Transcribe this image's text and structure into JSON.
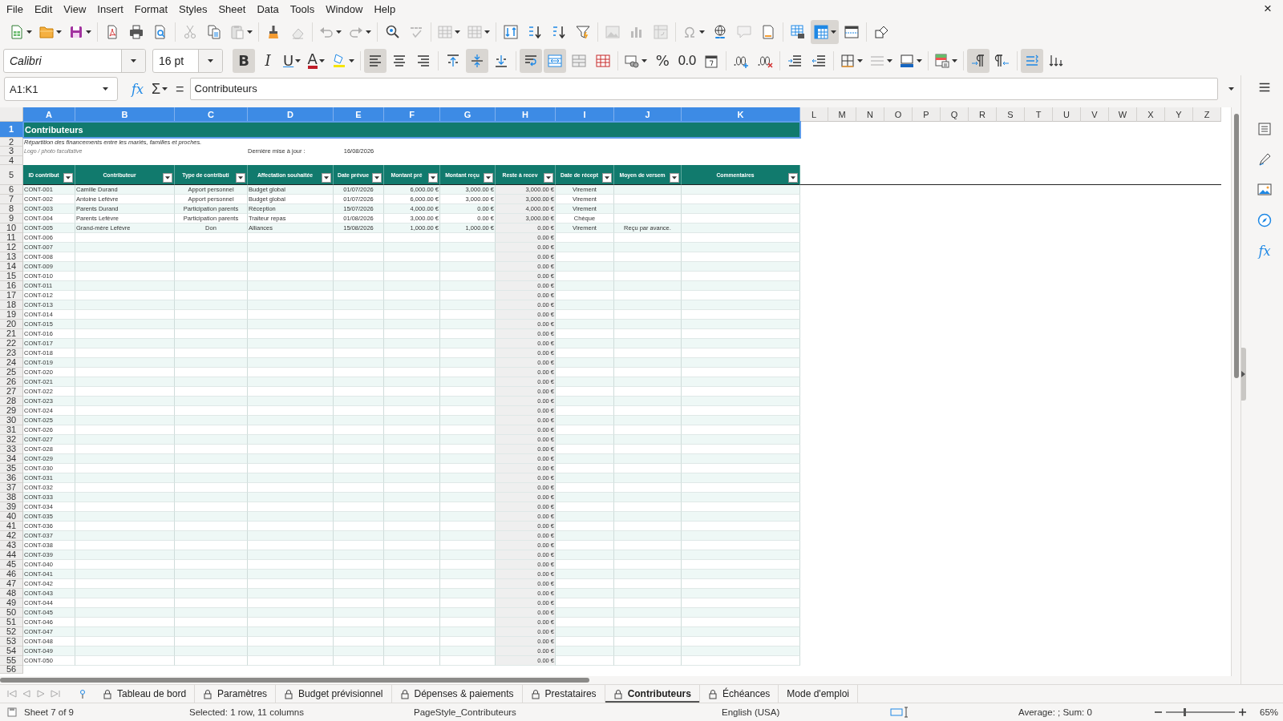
{
  "menu": [
    "File",
    "Edit",
    "View",
    "Insert",
    "Format",
    "Styles",
    "Sheet",
    "Data",
    "Tools",
    "Window",
    "Help"
  ],
  "close": "×",
  "toolbars": [
    {
      "groups": [
        [
          {
            "kind": "new",
            "dropdown": true,
            "active": false,
            "disabled": false
          },
          {
            "kind": "open",
            "dropdown": true,
            "active": false,
            "disabled": false
          },
          {
            "kind": "save",
            "dropdown": true,
            "active": false,
            "disabled": false
          }
        ],
        [
          {
            "kind": "export_pdf",
            "dropdown": false,
            "active": false,
            "disabled": false
          },
          {
            "kind": "print",
            "dropdown": false,
            "active": false,
            "disabled": false
          },
          {
            "kind": "print_preview",
            "dropdown": false,
            "active": false,
            "disabled": false
          }
        ],
        [
          {
            "kind": "cut",
            "dropdown": false,
            "active": false,
            "disabled": true
          },
          {
            "kind": "copy",
            "dropdown": false,
            "active": false,
            "disabled": false
          },
          {
            "kind": "paste",
            "dropdown": true,
            "active": false,
            "disabled": true
          }
        ],
        [
          {
            "kind": "clone_format",
            "dropdown": false,
            "active": false,
            "disabled": false
          },
          {
            "kind": "clear_format",
            "dropdown": false,
            "active": false,
            "disabled": true
          }
        ],
        [
          {
            "kind": "undo",
            "dropdown": true,
            "active": false,
            "disabled": true
          },
          {
            "kind": "redo",
            "dropdown": true,
            "active": false,
            "disabled": true
          }
        ],
        [
          {
            "kind": "find_replace",
            "dropdown": false,
            "active": false,
            "disabled": false
          },
          {
            "kind": "spelling",
            "dropdown": false,
            "active": false,
            "disabled": true
          }
        ],
        [
          {
            "kind": "rows",
            "dropdown": true,
            "active": false,
            "disabled": true
          },
          {
            "kind": "columns",
            "dropdown": true,
            "active": false,
            "disabled": true
          }
        ],
        [
          {
            "kind": "sort",
            "dropdown": false,
            "active": false,
            "disabled": false
          },
          {
            "kind": "sort_asc",
            "dropdown": false,
            "active": false,
            "disabled": false
          },
          {
            "kind": "sort_desc",
            "dropdown": false,
            "active": false,
            "disabled": false
          },
          {
            "kind": "autofilter",
            "dropdown": false,
            "active": false,
            "disabled": false
          }
        ],
        [
          {
            "kind": "image",
            "dropdown": false,
            "active": false,
            "disabled": true
          },
          {
            "kind": "chart",
            "dropdown": false,
            "active": false,
            "disabled": true
          },
          {
            "kind": "pivot",
            "dropdown": false,
            "active": false,
            "disabled": true
          }
        ],
        [
          {
            "kind": "special_char",
            "dropdown": true,
            "active": false,
            "disabled": true
          },
          {
            "kind": "hyperlink",
            "dropdown": false,
            "active": false,
            "disabled": false
          },
          {
            "kind": "comment",
            "dropdown": false,
            "active": false,
            "disabled": true
          },
          {
            "kind": "header_footer",
            "dropdown": false,
            "active": false,
            "disabled": false
          }
        ],
        [
          {
            "kind": "print_area",
            "dropdown": false,
            "active": false,
            "disabled": false
          },
          {
            "kind": "freeze",
            "dropdown": true,
            "active": true,
            "disabled": false
          },
          {
            "kind": "split_window",
            "dropdown": false,
            "active": false,
            "disabled": false
          }
        ],
        [
          {
            "kind": "shapes",
            "dropdown": false,
            "active": false,
            "disabled": false
          }
        ]
      ]
    },
    {
      "font_name": "Calibri",
      "font_size": "16 pt",
      "groups": [
        [
          {
            "kind": "bold",
            "glyph": "B",
            "dropdown": false,
            "active": true,
            "disabled": false
          },
          {
            "kind": "italic",
            "glyph": "I",
            "dropdown": false,
            "active": false,
            "disabled": false
          },
          {
            "kind": "underline",
            "glyph": "U",
            "dropdown": true,
            "active": false,
            "disabled": false
          },
          {
            "kind": "font_color",
            "glyph": "A",
            "dropdown": true,
            "active": false,
            "disabled": false
          },
          {
            "kind": "highlight",
            "dropdown": true,
            "active": false,
            "disabled": false
          }
        ],
        [
          {
            "kind": "align_left",
            "dropdown": false,
            "active": true,
            "disabled": false
          },
          {
            "kind": "align_center",
            "dropdown": false,
            "active": false,
            "disabled": false
          },
          {
            "kind": "align_right",
            "dropdown": false,
            "active": false,
            "disabled": false
          }
        ],
        [
          {
            "kind": "align_top",
            "dropdown": false,
            "active": false,
            "disabled": false
          },
          {
            "kind": "align_middle",
            "dropdown": false,
            "active": true,
            "disabled": false
          },
          {
            "kind": "align_bottom",
            "dropdown": false,
            "active": false,
            "disabled": false
          }
        ],
        [
          {
            "kind": "wrap",
            "dropdown": false,
            "active": true,
            "disabled": false
          },
          {
            "kind": "merge_center",
            "dropdown": false,
            "active": true,
            "disabled": false
          },
          {
            "kind": "merge",
            "dropdown": false,
            "active": false,
            "disabled": false
          },
          {
            "kind": "unmerge",
            "dropdown": false,
            "active": false,
            "disabled": false
          }
        ],
        [
          {
            "kind": "currency",
            "dropdown": true,
            "active": false,
            "disabled": false
          },
          {
            "kind": "percent",
            "glyph": "%",
            "dropdown": false,
            "active": false,
            "disabled": false
          },
          {
            "kind": "number",
            "glyph": "0.0",
            "dropdown": false,
            "active": false,
            "disabled": false
          },
          {
            "kind": "date",
            "dropdown": false,
            "active": false,
            "disabled": false
          }
        ],
        [
          {
            "kind": "add_decimal",
            "dropdown": false,
            "active": false,
            "disabled": false
          },
          {
            "kind": "delete_decimal",
            "dropdown": false,
            "active": false,
            "disabled": false
          }
        ],
        [
          {
            "kind": "indent_more",
            "dropdown": false,
            "active": false,
            "disabled": false
          },
          {
            "kind": "indent_less",
            "dropdown": false,
            "active": false,
            "disabled": false
          }
        ],
        [
          {
            "kind": "borders",
            "dropdown": true,
            "active": false,
            "disabled": false
          },
          {
            "kind": "border_style",
            "dropdown": true,
            "active": false,
            "disabled": true
          },
          {
            "kind": "border_color",
            "dropdown": true,
            "active": false,
            "disabled": false
          }
        ],
        [
          {
            "kind": "conditional",
            "dropdown": true,
            "active": false,
            "disabled": false
          }
        ],
        [
          {
            "kind": "ltr",
            "dropdown": false,
            "active": true,
            "disabled": false
          },
          {
            "kind": "rtl",
            "dropdown": false,
            "active": false,
            "disabled": false
          }
        ],
        [
          {
            "kind": "text_direction",
            "dropdown": false,
            "active": true,
            "disabled": false
          },
          {
            "kind": "vertical_text",
            "dropdown": false,
            "active": false,
            "disabled": false
          }
        ]
      ]
    }
  ],
  "formula_bar": {
    "name_box": "A1:K1",
    "function_wizard": "fx",
    "sum": "Σ",
    "formula": "=",
    "content": "Contributeurs"
  },
  "sidebar": {
    "panels": [
      {
        "kind": "properties"
      },
      {
        "kind": "styles"
      },
      {
        "kind": "gallery"
      },
      {
        "kind": "navigator"
      },
      {
        "kind": "functions",
        "glyph": "fx"
      }
    ]
  },
  "sheet": {
    "columns": [
      {
        "label": "A",
        "selected": true
      },
      {
        "label": "B",
        "selected": true
      },
      {
        "label": "C",
        "selected": true
      },
      {
        "label": "D",
        "selected": true
      },
      {
        "label": "E",
        "selected": true
      },
      {
        "label": "F",
        "selected": true
      },
      {
        "label": "G",
        "selected": true
      },
      {
        "label": "H",
        "selected": true
      },
      {
        "label": "I",
        "selected": true
      },
      {
        "label": "J",
        "selected": true
      },
      {
        "label": "K",
        "selected": true
      },
      {
        "label": "L",
        "selected": false
      },
      {
        "label": "M",
        "selected": false
      },
      {
        "label": "N",
        "selected": false
      },
      {
        "label": "O",
        "selected": false
      },
      {
        "label": "P",
        "selected": false
      },
      {
        "label": "Q",
        "selected": false
      },
      {
        "label": "R",
        "selected": false
      },
      {
        "label": "S",
        "selected": false
      },
      {
        "label": "T",
        "selected": false
      },
      {
        "label": "U",
        "selected": false
      },
      {
        "label": "V",
        "selected": false
      },
      {
        "label": "W",
        "selected": false
      },
      {
        "label": "X",
        "selected": false
      },
      {
        "label": "Y",
        "selected": false
      },
      {
        "label": "Z",
        "selected": false
      }
    ],
    "row_headers": [
      {
        "label": "1",
        "selected": true
      },
      {
        "label": "2",
        "selected": false
      },
      {
        "label": "3",
        "selected": false
      },
      {
        "label": "4",
        "selected": false
      },
      {
        "label": "5",
        "selected": false
      },
      {
        "label": "6",
        "selected": false
      },
      {
        "label": "7",
        "selected": false
      },
      {
        "label": "8",
        "selected": false
      },
      {
        "label": "9",
        "selected": false
      },
      {
        "label": "10",
        "selected": false
      },
      {
        "label": "11",
        "selected": false
      },
      {
        "label": "12",
        "selected": false
      },
      {
        "label": "13",
        "selected": false
      },
      {
        "label": "14",
        "selected": false
      },
      {
        "label": "15",
        "selected": false
      },
      {
        "label": "16",
        "selected": false
      },
      {
        "label": "17",
        "selected": false
      },
      {
        "label": "18",
        "selected": false
      },
      {
        "label": "19",
        "selected": false
      },
      {
        "label": "20",
        "selected": false
      },
      {
        "label": "21",
        "selected": false
      },
      {
        "label": "22",
        "selected": false
      },
      {
        "label": "23",
        "selected": false
      },
      {
        "label": "24",
        "selected": false
      },
      {
        "label": "25",
        "selected": false
      },
      {
        "label": "26",
        "selected": false
      },
      {
        "label": "27",
        "selected": false
      },
      {
        "label": "28",
        "selected": false
      },
      {
        "label": "29",
        "selected": false
      },
      {
        "label": "30",
        "selected": false
      },
      {
        "label": "31",
        "selected": false
      },
      {
        "label": "32",
        "selected": false
      },
      {
        "label": "33",
        "selected": false
      },
      {
        "label": "34",
        "selected": false
      },
      {
        "label": "35",
        "selected": false
      },
      {
        "label": "36",
        "selected": false
      },
      {
        "label": "37",
        "selected": false
      },
      {
        "label": "38",
        "selected": false
      },
      {
        "label": "39",
        "selected": false
      },
      {
        "label": "40",
        "selected": false
      },
      {
        "label": "41",
        "selected": false
      },
      {
        "label": "42",
        "selected": false
      },
      {
        "label": "43",
        "selected": false
      },
      {
        "label": "44",
        "selected": false
      },
      {
        "label": "45",
        "selected": false
      },
      {
        "label": "46",
        "selected": false
      },
      {
        "label": "47",
        "selected": false
      },
      {
        "label": "48",
        "selected": false
      },
      {
        "label": "49",
        "selected": false
      },
      {
        "label": "50",
        "selected": false
      },
      {
        "label": "51",
        "selected": false
      },
      {
        "label": "52",
        "selected": false
      },
      {
        "label": "53",
        "selected": false
      },
      {
        "label": "54",
        "selected": false
      },
      {
        "label": "55",
        "selected": false
      },
      {
        "label": "56",
        "selected": false
      }
    ],
    "title": "Contributeurs",
    "subtitle": "Répartition des financements entre les mariés, familles et proches.",
    "logo_note": "Logo / photo facultative",
    "updated_label": "Dernière mise à jour :",
    "updated_date": "16/08/2026",
    "table": {
      "headers": [
        "ID contribut",
        "Contributeur",
        "Type de contributi",
        "Affectation souhaitée",
        "Date prévue",
        "Montant pré",
        "Montant reçu",
        "Reste à recev",
        "Date de récept",
        "Moyen de versem",
        "Commentaires"
      ],
      "rows": [
        {
          "A": "CONT-001",
          "B": "Camille Durand",
          "C": "Apport personnel",
          "D": "Budget global",
          "E": "01/07/2026",
          "F": "6,000.00 €",
          "G": "3,000.00 €",
          "H": "3,000.00 €",
          "I": "Virement"
        },
        {
          "A": "CONT-002",
          "B": "Antoine Lefèvre",
          "C": "Apport personnel",
          "D": "Budget global",
          "E": "01/07/2026",
          "F": "6,000.00 €",
          "G": "3,000.00 €",
          "H": "3,000.00 €",
          "I": "Virement"
        },
        {
          "A": "CONT-003",
          "B": "Parents Durand",
          "C": "Participation parents",
          "D": "Réception",
          "E": "15/07/2026",
          "F": "4,000.00 €",
          "G": "0.00 €",
          "H": "4,000.00 €",
          "I": "Virement"
        },
        {
          "A": "CONT-004",
          "B": "Parents Lefèvre",
          "C": "Participation parents",
          "D": "Traiteur repas",
          "E": "01/08/2026",
          "F": "3,000.00 €",
          "G": "0.00 €",
          "H": "3,000.00 €",
          "I": "Chèque"
        },
        {
          "A": "CONT-005",
          "B": "Grand-mère Lefèvre",
          "C": "Don",
          "D": "Alliances",
          "E": "15/08/2026",
          "F": "1,000.00 €",
          "G": "1,000.00 €",
          "H": "0.00 €",
          "I": "Virement",
          "J": "Reçu par avance."
        },
        {
          "A": "CONT-006",
          "H": "0.00 €"
        },
        {
          "A": "CONT-007",
          "H": "0.00 €"
        },
        {
          "A": "CONT-008",
          "H": "0.00 €"
        },
        {
          "A": "CONT-009",
          "H": "0.00 €"
        },
        {
          "A": "CONT-010",
          "H": "0.00 €"
        },
        {
          "A": "CONT-011",
          "H": "0.00 €"
        },
        {
          "A": "CONT-012",
          "H": "0.00 €"
        },
        {
          "A": "CONT-013",
          "H": "0.00 €"
        },
        {
          "A": "CONT-014",
          "H": "0.00 €"
        },
        {
          "A": "CONT-015",
          "H": "0.00 €"
        },
        {
          "A": "CONT-016",
          "H": "0.00 €"
        },
        {
          "A": "CONT-017",
          "H": "0.00 €"
        },
        {
          "A": "CONT-018",
          "H": "0.00 €"
        },
        {
          "A": "CONT-019",
          "H": "0.00 €"
        },
        {
          "A": "CONT-020",
          "H": "0.00 €"
        },
        {
          "A": "CONT-021",
          "H": "0.00 €"
        },
        {
          "A": "CONT-022",
          "H": "0.00 €"
        },
        {
          "A": "CONT-023",
          "H": "0.00 €"
        },
        {
          "A": "CONT-024",
          "H": "0.00 €"
        },
        {
          "A": "CONT-025",
          "H": "0.00 €"
        },
        {
          "A": "CONT-026",
          "H": "0.00 €"
        },
        {
          "A": "CONT-027",
          "H": "0.00 €"
        },
        {
          "A": "CONT-028",
          "H": "0.00 €"
        },
        {
          "A": "CONT-029",
          "H": "0.00 €"
        },
        {
          "A": "CONT-030",
          "H": "0.00 €"
        },
        {
          "A": "CONT-031",
          "H": "0.00 €"
        },
        {
          "A": "CONT-032",
          "H": "0.00 €"
        },
        {
          "A": "CONT-033",
          "H": "0.00 €"
        },
        {
          "A": "CONT-034",
          "H": "0.00 €"
        },
        {
          "A": "CONT-035",
          "H": "0.00 €"
        },
        {
          "A": "CONT-036",
          "H": "0.00 €"
        },
        {
          "A": "CONT-037",
          "H": "0.00 €"
        },
        {
          "A": "CONT-038",
          "H": "0.00 €"
        },
        {
          "A": "CONT-039",
          "H": "0.00 €"
        },
        {
          "A": "CONT-040",
          "H": "0.00 €"
        },
        {
          "A": "CONT-041",
          "H": "0.00 €"
        },
        {
          "A": "CONT-042",
          "H": "0.00 €"
        },
        {
          "A": "CONT-043",
          "H": "0.00 €"
        },
        {
          "A": "CONT-044",
          "H": "0.00 €"
        },
        {
          "A": "CONT-045",
          "H": "0.00 €"
        },
        {
          "A": "CONT-046",
          "H": "0.00 €"
        },
        {
          "A": "CONT-047",
          "H": "0.00 €"
        },
        {
          "A": "CONT-048",
          "H": "0.00 €"
        },
        {
          "A": "CONT-049",
          "H": "0.00 €"
        },
        {
          "A": "CONT-050",
          "H": "0.00 €"
        }
      ]
    }
  },
  "sheet_tabs": [
    {
      "label": "Tableau de bord",
      "locked": true,
      "selected": false
    },
    {
      "label": "Paramètres",
      "locked": true,
      "selected": false
    },
    {
      "label": "Budget prévisionnel",
      "locked": true,
      "selected": false
    },
    {
      "label": "Dépenses & paiements",
      "locked": true,
      "selected": false
    },
    {
      "label": "Prestataires",
      "locked": true,
      "selected": false
    },
    {
      "label": "Contributeurs",
      "locked": true,
      "selected": true
    },
    {
      "label": "Échéances",
      "locked": true,
      "selected": false
    },
    {
      "label": "Mode d'emploi",
      "locked": false,
      "selected": false
    }
  ],
  "status_bar": {
    "sheet": "Sheet 7 of 9",
    "selection": "Selected: 1 row, 11 columns",
    "page_style": "PageStyle_Contributeurs",
    "language": "English (USA)",
    "summary": "Average: ; Sum: 0",
    "zoom": {
      "level": 0.27,
      "reading": "65%"
    }
  }
}
